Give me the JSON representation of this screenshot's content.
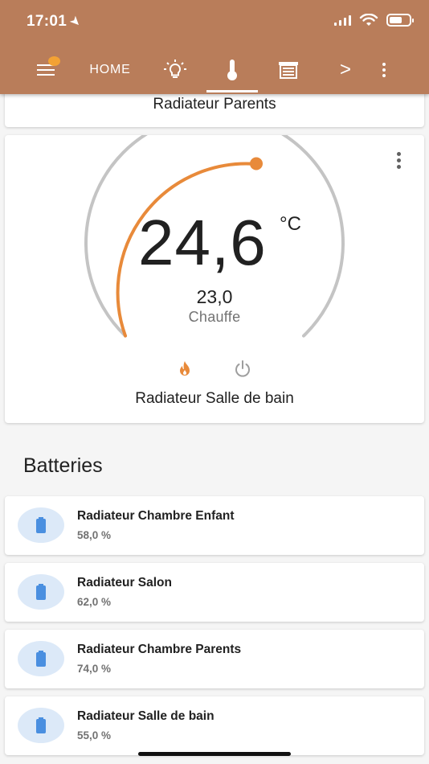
{
  "status_bar": {
    "time": "17:01",
    "battery_fraction": 0.65
  },
  "nav": {
    "tabs": [
      {
        "label": "HOME",
        "icon": "home-text"
      },
      {
        "icon": "lightbulb-icon"
      },
      {
        "icon": "thermometer-icon",
        "active": true
      },
      {
        "icon": "garage-icon"
      },
      {
        "icon": "chevron-right-icon"
      }
    ],
    "more_label": ">",
    "accent_color": "#b97d5a",
    "notification_color": "#f3a234"
  },
  "climate_cards": {
    "parents": {
      "name": "Radiateur Parents"
    },
    "salle_de_bain": {
      "name": "Radiateur Salle de bain",
      "current_temperature": "24,6",
      "unit": "°C",
      "target_temperature": "23,0",
      "hvac_action": "Chauffe",
      "modes": [
        "heat",
        "off"
      ],
      "active_mode": "heat",
      "arc_color": "#e88a3a",
      "track_color": "#c4c4c4"
    }
  },
  "batteries": {
    "title": "Batteries",
    "items": [
      {
        "name": "Radiateur Chambre Enfant",
        "value": "58,0 %"
      },
      {
        "name": "Radiateur Salon",
        "value": "62,0 %"
      },
      {
        "name": "Radiateur Chambre Parents",
        "value": "74,0 %"
      },
      {
        "name": "Radiateur Salle de bain",
        "value": "55,0 %"
      }
    ],
    "icon_color": "#4a8fe0",
    "icon_bg": "#dce9f8"
  }
}
